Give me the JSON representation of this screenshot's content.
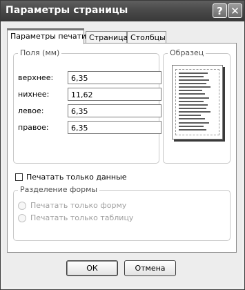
{
  "window": {
    "title": "Параметры страницы"
  },
  "title_buttons": {
    "help": "?",
    "close": "✕"
  },
  "tabs": [
    {
      "label": "Параметры печати",
      "active": true
    },
    {
      "label": "Страница",
      "active": false
    },
    {
      "label": "Столбцы",
      "active": false
    }
  ],
  "margins_group": {
    "legend": "Поля (мм)",
    "fields": [
      {
        "label": "верхнее:",
        "value": "6,35"
      },
      {
        "label": "нихнее:",
        "value": "11,62"
      },
      {
        "label": "левое:",
        "value": "6,35"
      },
      {
        "label": "правое:",
        "value": "6,35"
      }
    ]
  },
  "sample_group": {
    "legend": "Образец"
  },
  "print_data_only": {
    "label": "Печатать только данные",
    "checked": false
  },
  "form_split_group": {
    "legend": "Разделение формы",
    "options": [
      {
        "label": "Печатать только форму",
        "enabled": false
      },
      {
        "label": "Печатать только таблицу",
        "enabled": false
      }
    ]
  },
  "buttons": {
    "ok": "ОК",
    "cancel": "Отмена"
  }
}
